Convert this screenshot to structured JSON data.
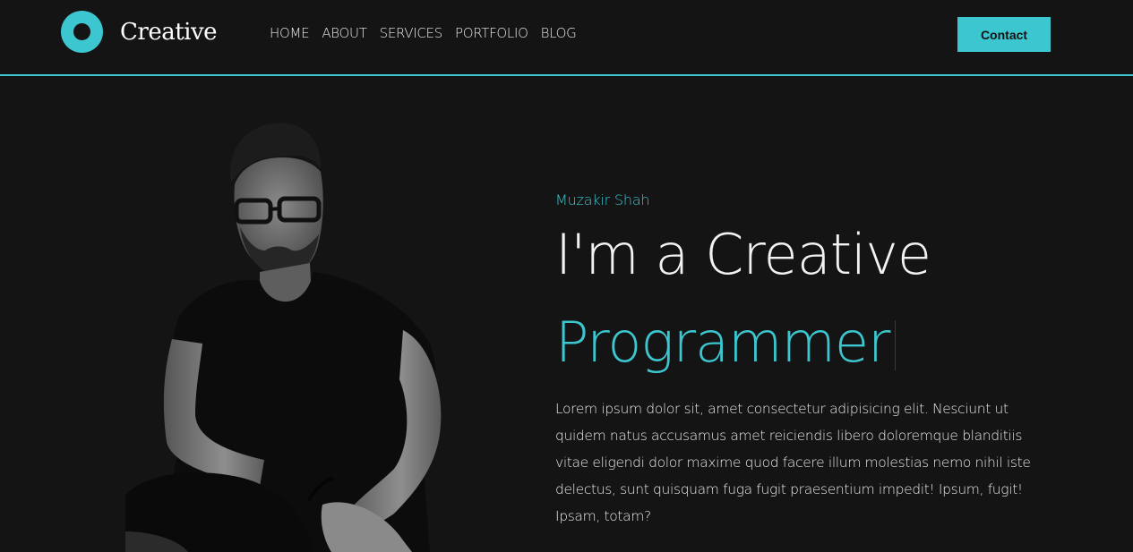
{
  "brand": {
    "name": "Creative",
    "accent_color": "#3cc6cf",
    "logo_icon": "ring-icon"
  },
  "nav": {
    "items": [
      {
        "label": "HOME"
      },
      {
        "label": "ABOUT"
      },
      {
        "label": "SERVICES"
      },
      {
        "label": "PORTFOLIO"
      },
      {
        "label": "BLOG"
      }
    ],
    "contact_label": "Contact"
  },
  "hero": {
    "name": "Muzakir Shah",
    "title": "I'm a Creative",
    "role": "Programmer",
    "description": "Lorem ipsum dolor sit, amet consectetur adipisicing elit. Nesciunt ut quidem natus accusamus amet reiciendis libero doloremque blanditiis vitae eligendi dolor maxime quod facere illum molestias nemo nihil iste delectus, sunt quisquam fuga fugit praesentium impedit! Ipsum, fugit! Ipsam, totam?",
    "portrait_alt": "Portrait photo of Muzakir Shah"
  },
  "colors": {
    "background": "#141415",
    "accent": "#3cc6cf",
    "text": "#e6e6e6"
  }
}
